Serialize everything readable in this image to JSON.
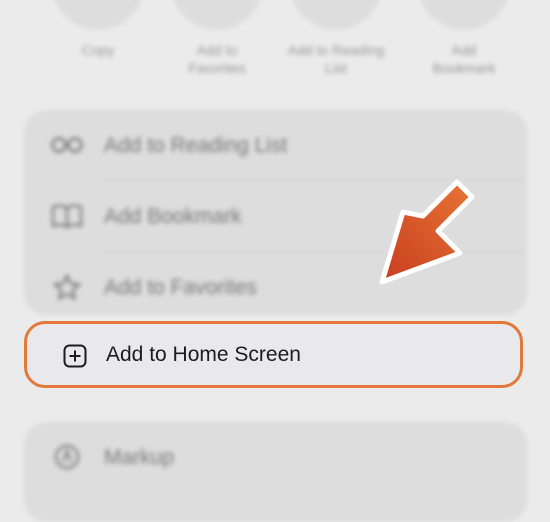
{
  "top_actions": [
    {
      "label": "Copy",
      "icon": "copy-icon"
    },
    {
      "label": "Add to Favorites",
      "icon": "star-icon"
    },
    {
      "label": "Add to Reading List",
      "icon": "glasses-icon"
    },
    {
      "label": "Add Bookmark",
      "icon": "book-icon"
    }
  ],
  "menu": {
    "items": [
      {
        "label": "Add to Reading List",
        "icon": "glasses-icon"
      },
      {
        "label": "Add Bookmark",
        "icon": "book-icon"
      },
      {
        "label": "Add to Favorites",
        "icon": "star-icon"
      }
    ],
    "highlighted": {
      "label": "Add to Home Screen",
      "icon": "plus-square-icon"
    }
  },
  "second_group": {
    "items": [
      {
        "label": "Markup",
        "icon": "markup-icon"
      }
    ]
  },
  "colors": {
    "highlight_border": "#e2793a",
    "arrow": "#d8552a"
  }
}
